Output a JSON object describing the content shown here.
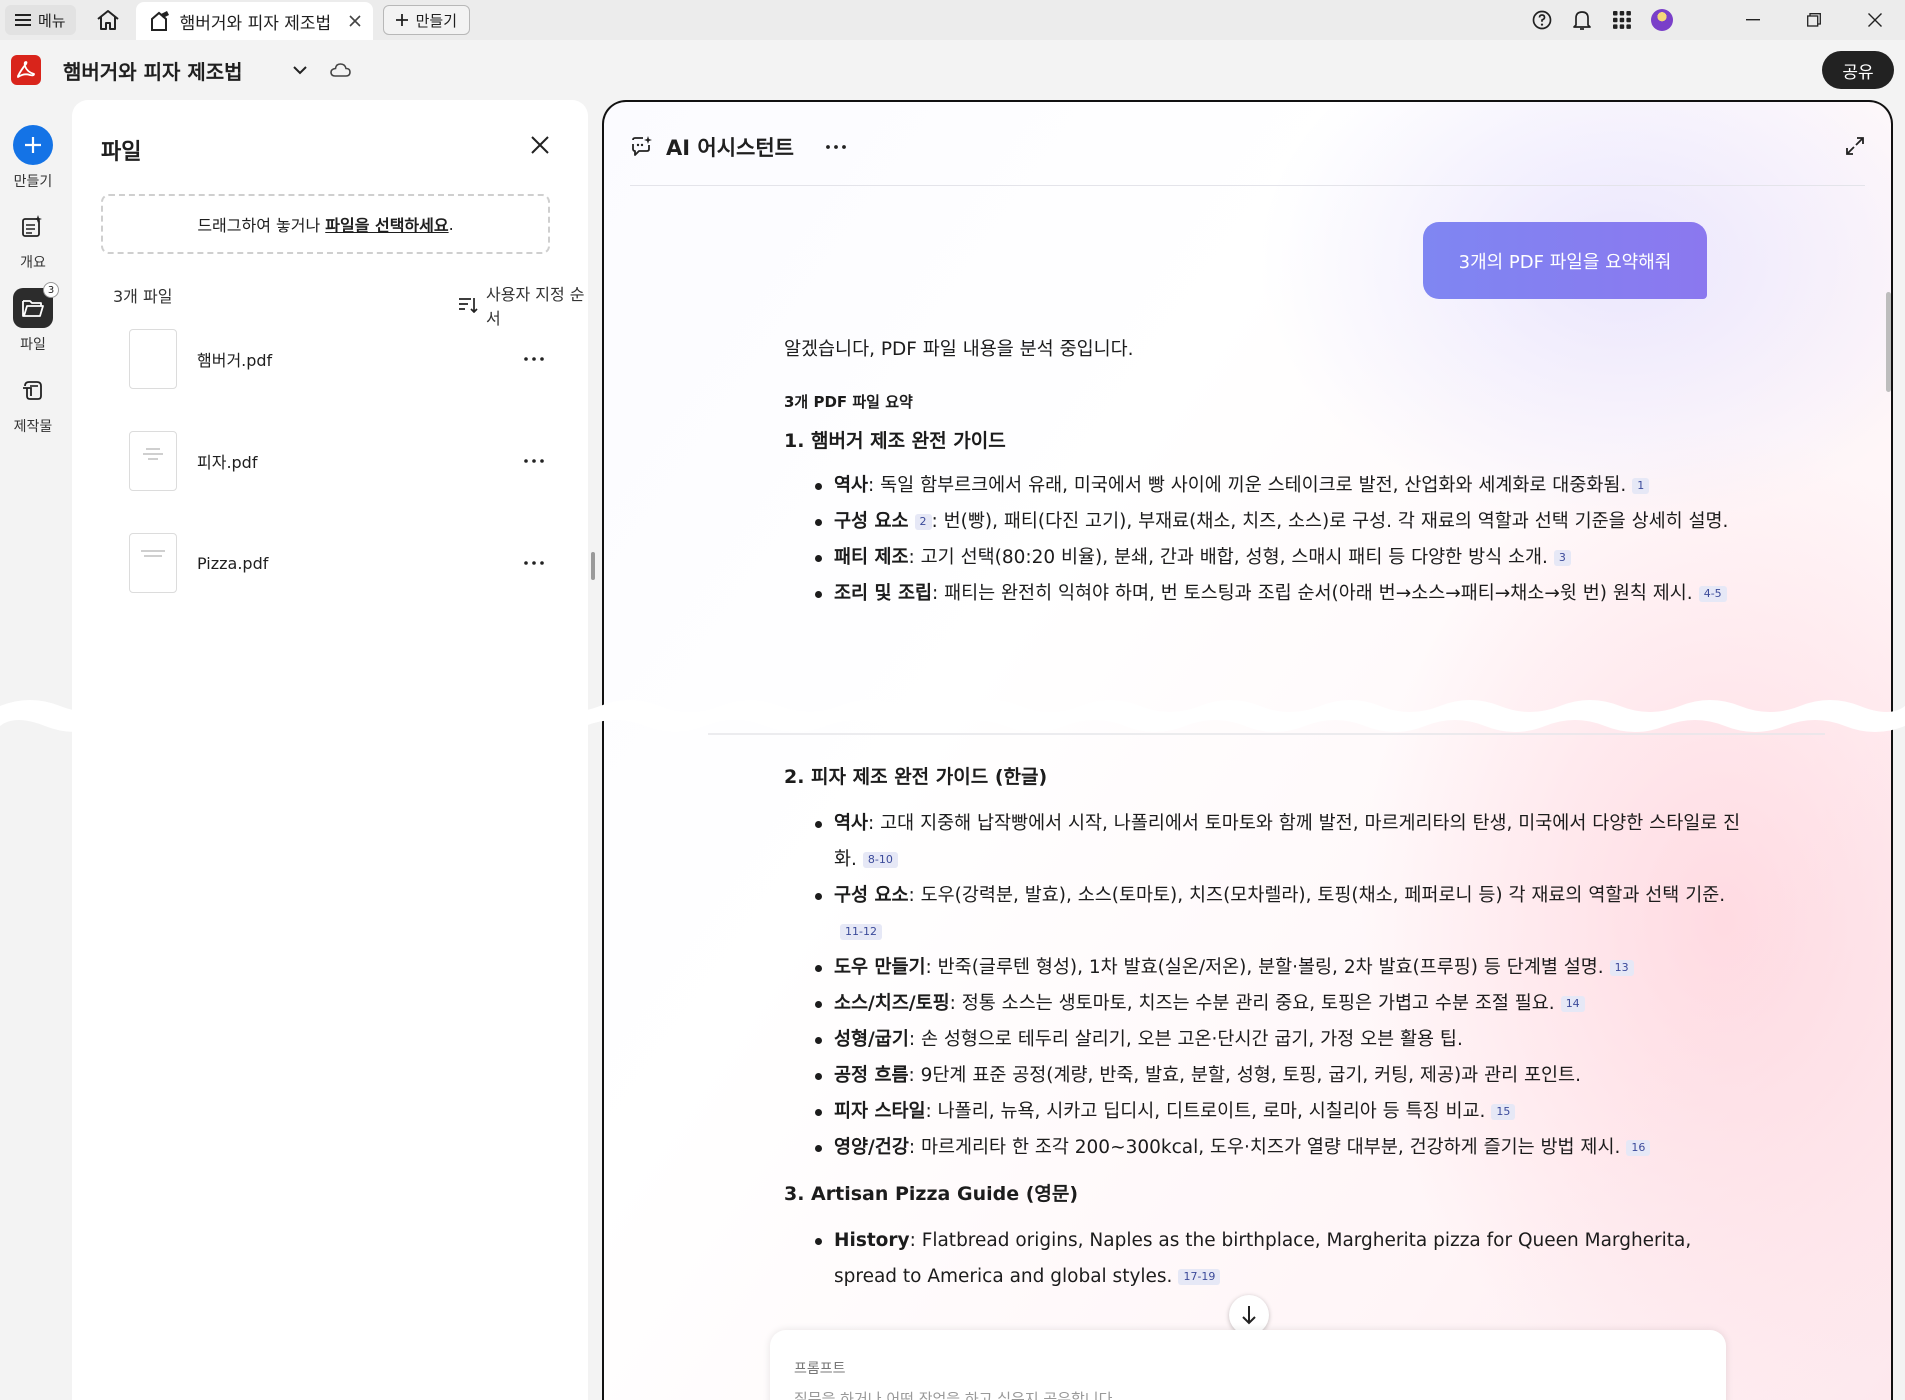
{
  "titlebar": {
    "menu_label": "메뉴",
    "tab_title": "햄버거와 피자 제조법",
    "new_tab_label": "만들기"
  },
  "appbar": {
    "doc_title": "햄버거와 피자 제조법",
    "share_label": "공유"
  },
  "rail": {
    "items": [
      {
        "label": "만들기",
        "icon": "plus-icon"
      },
      {
        "label": "개요",
        "icon": "overview-icon"
      },
      {
        "label": "파일",
        "icon": "folder-icon",
        "badge": "3"
      },
      {
        "label": "제작물",
        "icon": "creations-icon"
      }
    ]
  },
  "files": {
    "title": "파일",
    "drop_prefix": "드래그하여 놓거나 ",
    "drop_link": "파일을 선택하세요",
    "drop_suffix": ".",
    "count": "3개 파일",
    "sort_label": "사용자 지정 순서",
    "items": [
      {
        "name": "햄버거.pdf"
      },
      {
        "name": "피자.pdf"
      },
      {
        "name": "Pizza.pdf"
      }
    ]
  },
  "ai": {
    "title": "AI 어시스턴트",
    "user_message": "3개의 PDF 파일을 요약해줘",
    "intro": "알겠습니다, PDF 파일 내용을 분석 중입니다.",
    "summary_heading": "3개 PDF 파일 요약",
    "sections": [
      {
        "title": "1. 햄버거 제조 완전 가이드",
        "bullets": [
          {
            "term": "역사",
            "text": ": 독일 함부르크에서 유래, 미국에서 빵 사이에 끼운 스테이크로 발전, 산업화와 세계화로 대중화됨.",
            "cite": "1"
          },
          {
            "term": "구성 요소",
            "cite_inline": "2",
            "text": ": 번(빵), 패티(다진 고기), 부재료(채소, 치즈, 소스)로 구성. 각 재료의 역할과 선택 기준을 상세히 설명."
          },
          {
            "term": "패티 제조",
            "text": ": 고기 선택(80:20 비율), 분쇄, 간과 배합, 성형, 스매시 패티 등 다양한 방식 소개.",
            "cite": "3"
          },
          {
            "term": "조리 및 조립",
            "text": ": 패티는 완전히 익혀야 하며, 번 토스팅과 조립 순서(아래 번→소스→패티→채소→윗 번) 원칙 제시.",
            "cite": "4-5"
          }
        ]
      },
      {
        "title": "2. 피자 제조 완전 가이드 (한글)",
        "bullets": [
          {
            "term": "역사",
            "text": ": 고대 지중해 납작빵에서 시작, 나폴리에서 토마토와 함께 발전, 마르게리타의 탄생, 미국에서 다양한 스타일로 진화.",
            "cite": "8-10"
          },
          {
            "term": "구성 요소",
            "text": ": 도우(강력분, 발효), 소스(토마토), 치즈(모차렐라), 토핑(채소, 페퍼로니 등) 각 재료의 역할과 선택 기준.",
            "cite": "11-12"
          },
          {
            "term": "도우 만들기",
            "text": ": 반죽(글루텐 형성), 1차 발효(실온/저온), 분할·볼링, 2차 발효(프루핑) 등 단계별 설명.",
            "cite": "13"
          },
          {
            "term": "소스/치즈/토핑",
            "text": ": 정통 소스는 생토마토, 치즈는 수분 관리 중요, 토핑은 가볍고 수분 조절 필요.",
            "cite": "14"
          },
          {
            "term": "성형/굽기",
            "text": ": 손 성형으로 테두리 살리기, 오븐 고온·단시간 굽기, 가정 오븐 활용 팁."
          },
          {
            "term": "공정 흐름",
            "text": ": 9단계 표준 공정(계량, 반죽, 발효, 분할, 성형, 토핑, 굽기, 커팅, 제공)과 관리 포인트."
          },
          {
            "term": "피자 스타일",
            "text": ": 나폴리, 뉴욕, 시카고 딥디시, 디트로이트, 로마, 시칠리아 등 특징 비교.",
            "cite": "15"
          },
          {
            "term": "영양/건강",
            "text": ": 마르게리타 한 조각 200~300kcal, 도우·치즈가 열량 대부분, 건강하게 즐기는 방법 제시.",
            "cite": "16"
          }
        ]
      },
      {
        "title": "3. Artisan Pizza Guide (영문)",
        "bullets": [
          {
            "term": "History",
            "text": ": Flatbread origins, Naples as the birthplace, Margherita pizza for Queen Margherita, spread to America and global styles.",
            "cite": "17-19"
          }
        ]
      }
    ],
    "prompt_label": "프롬프트",
    "prompt_placeholder": "질문을 하거나 어떤 작업을 하고 싶은지 공유합니다"
  }
}
